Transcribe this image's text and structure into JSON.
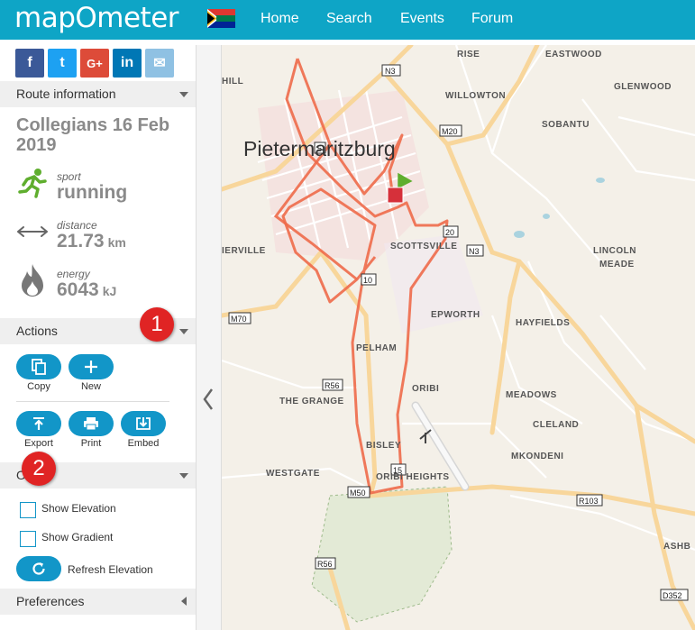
{
  "header": {
    "logo": "mapOmeter",
    "nav": [
      "Home",
      "Search",
      "Events",
      "Forum"
    ]
  },
  "share": {
    "facebook": "f",
    "twitter": "t",
    "google": "G+",
    "linkedin": "in",
    "email": "✉"
  },
  "route_info": {
    "section_label": "Route information",
    "title": "Collegians 16 Feb 2019",
    "sport_key": "sport",
    "sport_value": "running",
    "distance_key": "distance",
    "distance_value": "21.73",
    "distance_unit": "km",
    "energy_key": "energy",
    "energy_value": "6043",
    "energy_unit": "kJ"
  },
  "actions": {
    "section_label": "Actions",
    "copy": "Copy",
    "new": "New",
    "export": "Export",
    "print": "Print",
    "embed": "Embed"
  },
  "options": {
    "section_label": "O",
    "show_elevation": "Show Elevation",
    "show_gradient": "Show Gradient",
    "refresh_elevation": "Refresh Elevation"
  },
  "preferences": {
    "section_label": "Preferences"
  },
  "badges": [
    "1",
    "2"
  ],
  "map": {
    "city": "Pietermaritzburg",
    "places": [
      "HILL",
      "RISE",
      "EASTWOOD",
      "WILLOWTON",
      "GLENWOOD",
      "SOBANTU",
      "IERVILLE",
      "SCOTTSVILLE",
      "LINCOLN",
      "MEADE",
      "EPWORTH",
      "HAYFIELDS",
      "PELHAM",
      "THE GRANGE",
      "ORIBI",
      "MEADOWS",
      "CLELAND",
      "BISLEY",
      "WESTGATE",
      "MKONDENI",
      "ORIBI HEIGHTS",
      "ASHB"
    ],
    "roads": [
      "N3",
      "M20",
      "5",
      "20",
      "N3",
      "10",
      "M70",
      "R56",
      "15",
      "M50",
      "R103",
      "R56",
      "D352"
    ]
  },
  "colors": {
    "header": "#0ea5c6",
    "accent": "#1296c8",
    "route": "#ee6a4a",
    "badge": "#e02424",
    "sport_icon": "#5fae2e"
  }
}
